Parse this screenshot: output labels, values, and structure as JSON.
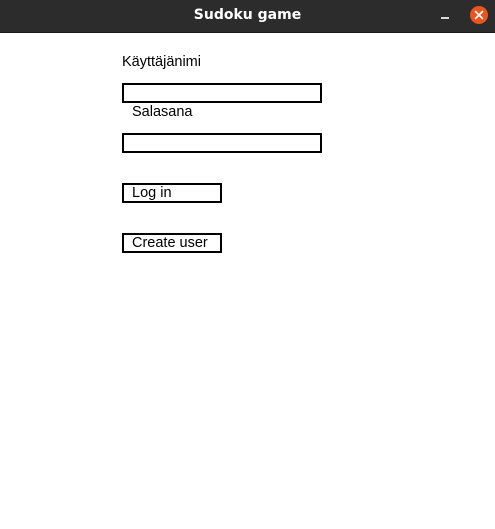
{
  "window": {
    "title": "Sudoku game"
  },
  "form": {
    "username_label": "Käyttäjänimi",
    "username_value": "",
    "password_label": "Salasana",
    "password_value": "",
    "login_button": "Log in",
    "create_user_button": "Create user"
  },
  "colors": {
    "titlebar": "#2c2c2c",
    "close_button": "#e9541f",
    "background": "#ffffff",
    "border": "#000000"
  },
  "icons": {
    "minimize": "minimize-icon",
    "close": "close-icon"
  }
}
